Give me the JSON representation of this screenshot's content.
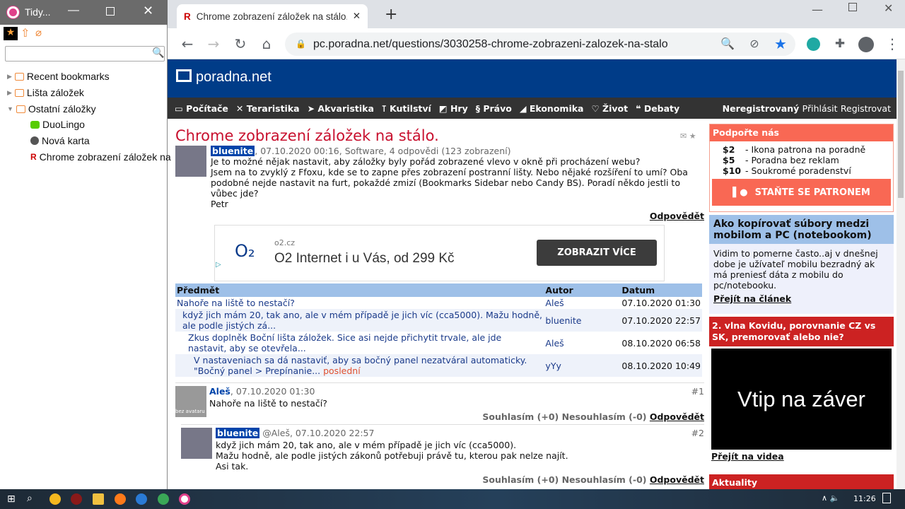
{
  "tidy": {
    "title": "Tidy...",
    "search_placeholder": "",
    "tree": [
      {
        "label": "Recent bookmarks",
        "type": "folder",
        "expanded": false
      },
      {
        "label": "Lišta záložek",
        "type": "folder",
        "expanded": false
      },
      {
        "label": "Ostatní záložky",
        "type": "folder",
        "expanded": true
      },
      {
        "label": "DuoLingo",
        "type": "bookmark"
      },
      {
        "label": "Nová karta",
        "type": "bookmark"
      },
      {
        "label": "Chrome zobrazení záložek na",
        "type": "bookmark"
      }
    ]
  },
  "browser": {
    "tab_title": "Chrome zobrazení záložek na stálo.",
    "url": "pc.poradna.net/questions/3030258-chrome-zobrazeni-zalozek-na-stalo"
  },
  "site": {
    "logo": "poradna.net",
    "nav": [
      "Počítače",
      "Teraristika",
      "Akvaristika",
      "Kutilství",
      "Hry",
      "Právo",
      "Ekonomika",
      "Život",
      "Debaty"
    ],
    "user_status": "Neregistrovaný",
    "login": "Přihlásit",
    "register": "Registrovat"
  },
  "question": {
    "title": "Chrome zobrazení záložek na stálo.",
    "author": "bluenite",
    "meta": ", 07.10.2020 00:16, Software, 4 odpovědi (123 zobrazení)",
    "body": [
      "Je to možné nějak nastavit, aby záložky byly pořád zobrazené vlevo v okně při procházení webu?",
      "Jsem na to zvyklý z Ffoxu, kde se to zapne přes zobrazení postranní lišty. Nebo nějaké rozšíření to umí? Oba podobné nejde nastavit na furt, pokaždé zmizí (Bookmarks Sidebar nebo Candy BS). Poradí někdo jestli to vůbec jde?",
      "Petr"
    ],
    "reply": "Odpovědět"
  },
  "ad": {
    "brand": "O₂",
    "domain": "o2.cz",
    "text": "O2 Internet i u Vás, od 299 Kč",
    "button": "ZOBRAZIT VÍCE"
  },
  "threads": {
    "headers": [
      "Předmět",
      "Autor",
      "Datum"
    ],
    "rows": [
      {
        "subject": "Nahoře na liště to nestačí?",
        "author": "Aleš",
        "date": "07.10.2020 01:30",
        "level": 0
      },
      {
        "subject": "když jich mám 20, tak ano, ale v mém případě je jich víc (cca5000). Mažu hodně, ale podle jistých zá...",
        "author": "bluenite",
        "date": "07.10.2020 22:57",
        "level": 1
      },
      {
        "subject": "Zkus doplněk Boční lišta záložek. Sice asi nejde přichytit trvale, ale jde nastavit, aby se otevřela...",
        "author": "Aleš",
        "date": "08.10.2020 06:58",
        "level": 2
      },
      {
        "subject": "V nastaveniach sa dá nastaviť, aby sa bočný panel nezatváral automaticky. \"Bočný panel > Prepínanie...",
        "author": "yYy",
        "date": "08.10.2020 10:49",
        "level": 3,
        "badge": "poslední"
      }
    ]
  },
  "answers": [
    {
      "author": "Aleš",
      "meta": ", 07.10.2020 01:30",
      "num": "#1",
      "avatar_label": "bez avataru",
      "body": [
        "Nahoře na liště to nestačí?"
      ],
      "agree": "Souhlasím (+0)",
      "disagree": "Nesouhlasím (-0)",
      "reply": "Odpovědět"
    },
    {
      "author": "bluenite",
      "meta": " @Aleš, 07.10.2020 22:57",
      "num": "#2",
      "body": [
        "když jich mám 20, tak ano, ale v mém případě je jich víc (cca5000).",
        "Mažu hodně, ale podle jistých zákonů potřebuji právě tu, kterou pak nelze najít.",
        "Asi tak."
      ],
      "agree": "Souhlasím (+0)",
      "disagree": "Nesouhlasím (-0)",
      "reply": "Odpovědět"
    }
  ],
  "sidebar": {
    "support": {
      "title": "Podpořte nás",
      "tiers": [
        {
          "price": "$2",
          "desc": "- Ikona patrona na poradně"
        },
        {
          "price": "$5",
          "desc": "- Poradna bez reklam"
        },
        {
          "price": "$10",
          "desc": "- Soukromé poradenství"
        }
      ],
      "button": "STAŇTE SE PATRONEM"
    },
    "article": {
      "title": "Ako kopírovať súbory medzi mobilom a PC (notebookom)",
      "text": "Vidim to pomerne často..aj v dnešnej dobe je užívateľ mobilu bezradný ak má preniesť dáta z mobilu do pc/notebooku.",
      "link": "Přejít na článek"
    },
    "video": {
      "title": "2. vlna Kovidu, porovnanie CZ vs SK, premorovať alebo nie?",
      "thumb_text": "Vtip na záver",
      "link": "Přejít na videa"
    },
    "news": {
      "title": "Aktuality"
    }
  },
  "taskbar": {
    "time": "11:26"
  },
  "colors": {
    "site_blue": "#003c88",
    "accent_red": "#cc2222",
    "patreon": "#f96854"
  }
}
